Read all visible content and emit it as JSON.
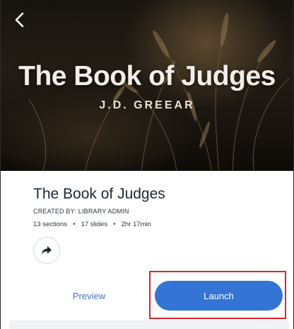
{
  "hero": {
    "title": "The Book of Judges",
    "author": "J.D. GREEAR",
    "back_icon": "chevron-left-icon"
  },
  "course": {
    "title": "The Book of Judges",
    "created_by": "CREATED BY: LIBRARY ADMIN",
    "sections": "13 sections",
    "slides": "17 slides",
    "duration": "2hr 17min",
    "separator": "•",
    "share_icon": "share-arrow-icon"
  },
  "actions": {
    "preview_label": "Preview",
    "launch_label": "Launch"
  },
  "colors": {
    "accent": "#3474d4",
    "link": "#3f79c4",
    "highlight": "#d9262c",
    "title_text": "#1d2733"
  }
}
